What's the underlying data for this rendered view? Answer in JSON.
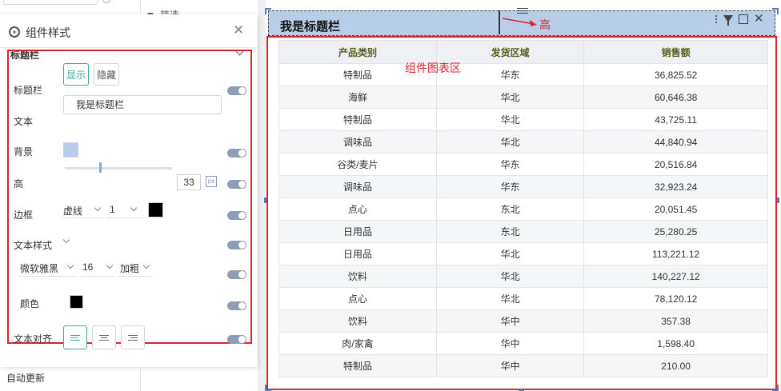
{
  "left_panel": {
    "auto_update": "自动更新"
  },
  "mid_panel": {
    "filter_label": "筛选"
  },
  "style_panel": {
    "title": "组件样式",
    "section": "标题栏",
    "rows": {
      "titlebar_label": "标题栏",
      "show_label": "显示",
      "hide_label": "隐藏",
      "text_label": "文本",
      "text_value": "我是标题栏",
      "background_label": "背景",
      "background_color": "#b8cde8",
      "height_label": "高",
      "height_value": "33",
      "height_unit": "px",
      "border_label": "边框",
      "border_style": "虚线",
      "border_width": "1",
      "border_color": "#000000",
      "text_style_label": "文本样式",
      "font_family": "微软雅黑",
      "font_size": "16",
      "font_weight": "加粗",
      "color_label": "颜色",
      "text_color": "#000000",
      "align_label": "文本对齐"
    }
  },
  "canvas": {
    "title_text": "我是标题栏",
    "height_annotation": "高",
    "chart_annotation": "组件图表区",
    "table": {
      "headers": [
        "产品类别",
        "发货区域",
        "销售额"
      ],
      "rows": [
        [
          "特制品",
          "华东",
          "36,825.52"
        ],
        [
          "海鲜",
          "华北",
          "60,646.38"
        ],
        [
          "特制品",
          "华北",
          "43,725.11"
        ],
        [
          "调味品",
          "华北",
          "44,840.94"
        ],
        [
          "谷类/麦片",
          "华东",
          "20,516.84"
        ],
        [
          "调味品",
          "华东",
          "32,923.24"
        ],
        [
          "点心",
          "东北",
          "20,051.45"
        ],
        [
          "日用品",
          "东北",
          "25,280.25"
        ],
        [
          "日用品",
          "华北",
          "113,221.12"
        ],
        [
          "饮料",
          "华北",
          "140,227.12"
        ],
        [
          "点心",
          "华北",
          "78,120.12"
        ],
        [
          "饮料",
          "华中",
          "357.38"
        ],
        [
          "肉/家禽",
          "华中",
          "1,598.40"
        ],
        [
          "特制品",
          "华中",
          "210.00"
        ]
      ]
    }
  },
  "colors": {
    "accent": "#3ea6a0",
    "annotation_red": "#d9262c",
    "titlebar_bg": "#b8cde8"
  }
}
